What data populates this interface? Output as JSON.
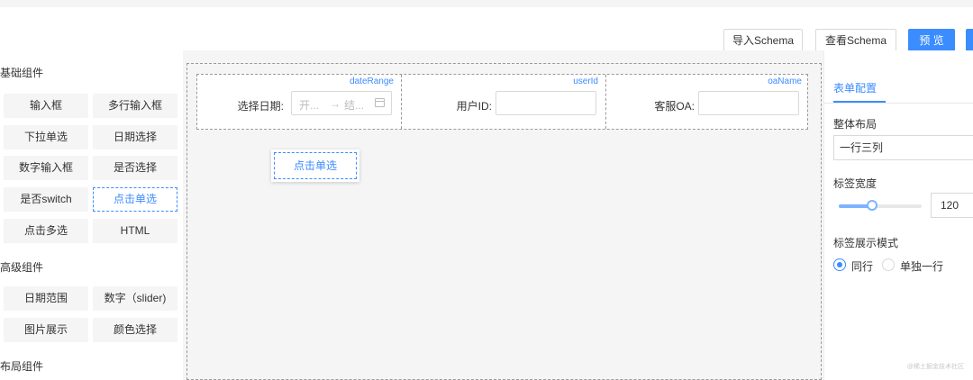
{
  "toolbar": {
    "import_label": "导入Schema",
    "view_label": "查看Schema",
    "preview_label": "预 览"
  },
  "sidebar": {
    "basic_title": "基础组件",
    "basic_items": [
      "输入框",
      "多行输入框",
      "下拉单选",
      "日期选择",
      "数字输入框",
      "是否选择",
      "是否switch",
      "点击单选",
      "点击多选",
      "HTML"
    ],
    "advanced_title": "高级组件",
    "advanced_items": [
      "日期范围",
      "数字（slider)",
      "图片展示",
      "颜色选择"
    ],
    "layout_title": "布局组件"
  },
  "canvas": {
    "fields": [
      {
        "key": "dateRange",
        "label": "选择日期:",
        "start_placeholder": "开...",
        "end_placeholder": "结..."
      },
      {
        "key": "userId",
        "label": "用户ID:"
      },
      {
        "key": "oaName",
        "label": "客服OA:"
      }
    ],
    "dragging_label": "点击单选"
  },
  "settings": {
    "tab_label": "表单配置",
    "layout_label": "整体布局",
    "layout_value": "一行三列",
    "label_width_label": "标签宽度",
    "label_width_value": "120",
    "label_width_slider_fraction": 0.4,
    "display_mode_label": "标签展示模式",
    "display_modes": [
      "同行",
      "单独一行"
    ],
    "selected_mode": "同行"
  },
  "watermark": "@稀土掘金技术社区",
  "colors": {
    "accent": "#3b8cff",
    "canvas_bg": "#f5f5f5",
    "item_bg": "#f5f5f5"
  }
}
